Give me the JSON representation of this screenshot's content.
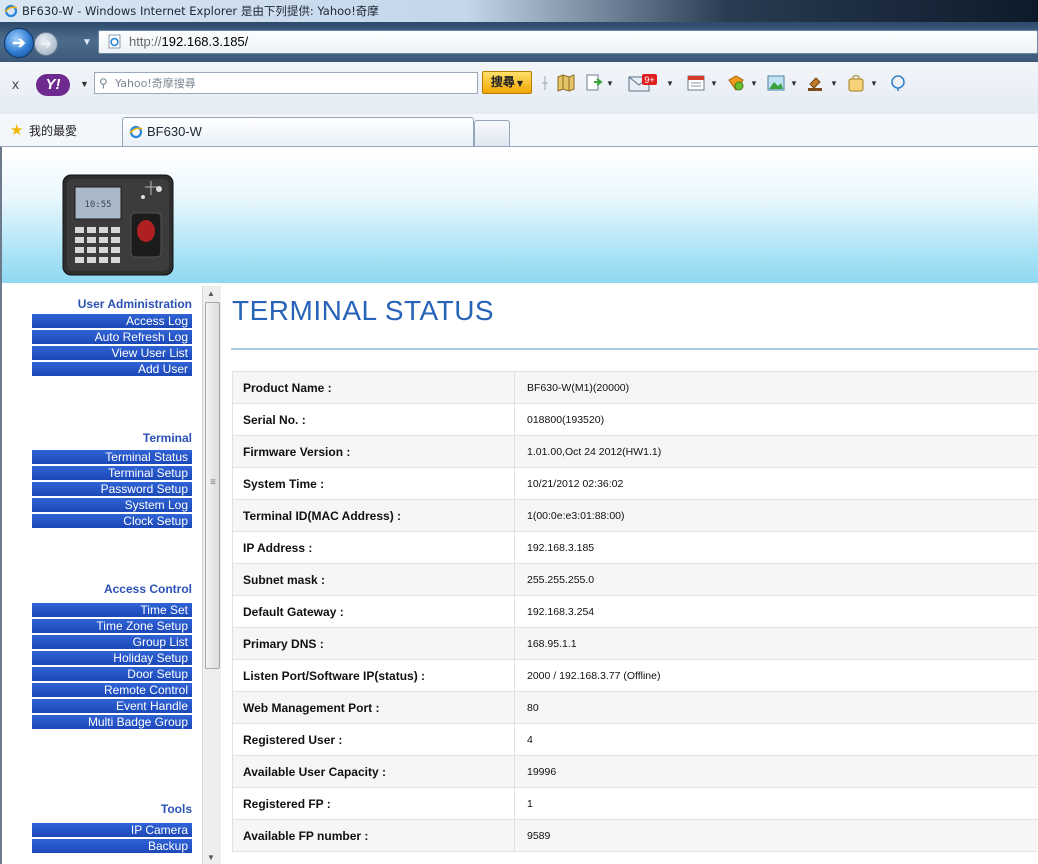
{
  "window": {
    "title": "BF630-W - Windows Internet Explorer 是由下列提供: Yahoo!奇摩"
  },
  "address_bar": {
    "url_prefix": "http://",
    "url_host": "192.168.3.185/"
  },
  "toolbar": {
    "close": "x",
    "logo": "Y!",
    "search_placeholder": "Yahoo!奇摩搜尋",
    "search_button": "搜尋",
    "mail_badge": "9+"
  },
  "favorites": {
    "label": "我的最愛"
  },
  "tabs": [
    {
      "label": "BF630-W"
    }
  ],
  "device_display": {
    "line1": "10:55"
  },
  "sidebar": {
    "sections": [
      {
        "title": "User Administration",
        "items": [
          "Access Log",
          "Auto Refresh Log",
          "View User List",
          "Add User"
        ]
      },
      {
        "title": "Terminal",
        "items": [
          "Terminal Status",
          "Terminal Setup",
          "Password Setup",
          "System Log",
          "Clock Setup"
        ]
      },
      {
        "title": "Access Control",
        "items": [
          "Time Set",
          "Time Zone Setup",
          "Group List",
          "Holiday Setup",
          "Door Setup",
          "Remote Control",
          "Event Handle",
          "Multi Badge Group"
        ]
      },
      {
        "title": "Tools",
        "items": [
          "IP Camera",
          "Backup"
        ]
      }
    ]
  },
  "main": {
    "title": "TERMINAL STATUS",
    "rows": [
      {
        "label": "Product Name :",
        "value": "BF630-W(M1)(20000)"
      },
      {
        "label": "Serial No. :",
        "value": "018800(193520)"
      },
      {
        "label": "Firmware Version :",
        "value": "1.01.00,Oct 24 2012(HW1.1)"
      },
      {
        "label": "System Time :",
        "value": "10/21/2012 02:36:02"
      },
      {
        "label": "Terminal ID(MAC Address) :",
        "value": "1(00:0e:e3:01:88:00)"
      },
      {
        "label": "IP Address :",
        "value": "192.168.3.185"
      },
      {
        "label": "Subnet mask :",
        "value": "255.255.255.0"
      },
      {
        "label": "Default Gateway :",
        "value": "192.168.3.254"
      },
      {
        "label": "Primary DNS :",
        "value": "168.95.1.1"
      },
      {
        "label": "Listen Port/Software IP(status) :",
        "value": "2000 / 192.168.3.77 (Offline)"
      },
      {
        "label": "Web Management Port :",
        "value": "80"
      },
      {
        "label": "Registered User :",
        "value": "4"
      },
      {
        "label": "Available User Capacity :",
        "value": "19996"
      },
      {
        "label": "Registered FP :",
        "value": "1"
      },
      {
        "label": "Available FP number :",
        "value": "9589"
      }
    ]
  }
}
